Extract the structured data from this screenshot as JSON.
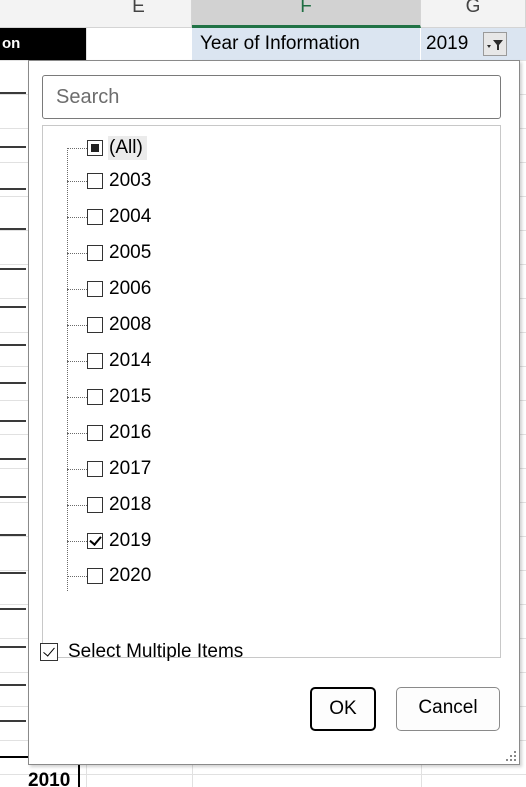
{
  "columns": [
    {
      "label": "E",
      "selected": false
    },
    {
      "label": "F",
      "selected": true
    },
    {
      "label": "G",
      "selected": false
    }
  ],
  "cells": {
    "left_partial": "on",
    "pivot_field_label": "Year of Information",
    "pivot_field_value": "2019",
    "bottom_partial": "2010"
  },
  "filter": {
    "search_placeholder": "Search",
    "items": [
      {
        "label": "(All)",
        "state": "partial"
      },
      {
        "label": "2003",
        "state": "unchecked"
      },
      {
        "label": "2004",
        "state": "unchecked"
      },
      {
        "label": "2005",
        "state": "unchecked"
      },
      {
        "label": "2006",
        "state": "unchecked"
      },
      {
        "label": "2008",
        "state": "unchecked"
      },
      {
        "label": "2014",
        "state": "unchecked"
      },
      {
        "label": "2015",
        "state": "unchecked"
      },
      {
        "label": "2016",
        "state": "unchecked"
      },
      {
        "label": "2017",
        "state": "unchecked"
      },
      {
        "label": "2018",
        "state": "unchecked"
      },
      {
        "label": "2019",
        "state": "checked"
      },
      {
        "label": "2020",
        "state": "unchecked"
      }
    ],
    "select_multiple_label": "Select Multiple Items",
    "select_multiple_checked": true,
    "ok_label": "OK",
    "cancel_label": "Cancel"
  },
  "icons": {
    "filter": "filter-dropdown-icon",
    "checkbox": "checkbox-icon",
    "resize": "resize-grip-icon"
  },
  "colors": {
    "selected_column_accent": "#217346",
    "pivot_cell_background": "#dbe5f1"
  }
}
